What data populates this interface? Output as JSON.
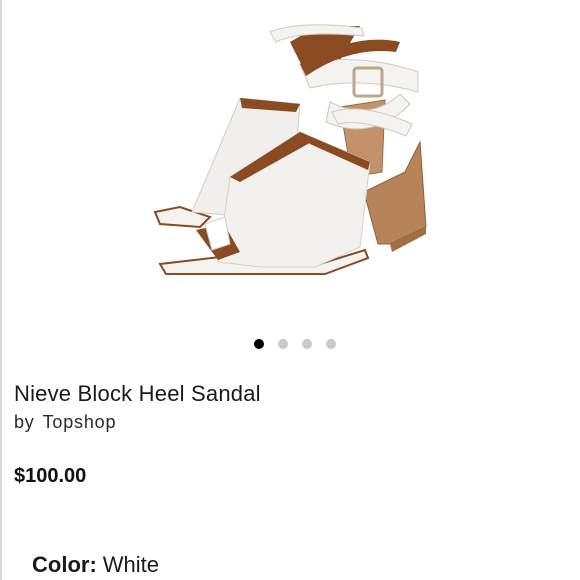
{
  "product": {
    "title": "Nieve Block Heel Sandal",
    "by_label": "by",
    "brand": "Topshop",
    "price": "$100.00",
    "color_label": "Color:",
    "color_value": "White",
    "image_icon": "white-block-heel-sandals-photo"
  },
  "carousel": {
    "slide_count": 4,
    "active_index": 0
  },
  "colors": {
    "active_dot": "#000000",
    "inactive_dot": "#c9c9c9",
    "leather_white": "#f4f3f0",
    "heel_wood": "#b7845a",
    "lining_brown": "#8a4a22"
  }
}
